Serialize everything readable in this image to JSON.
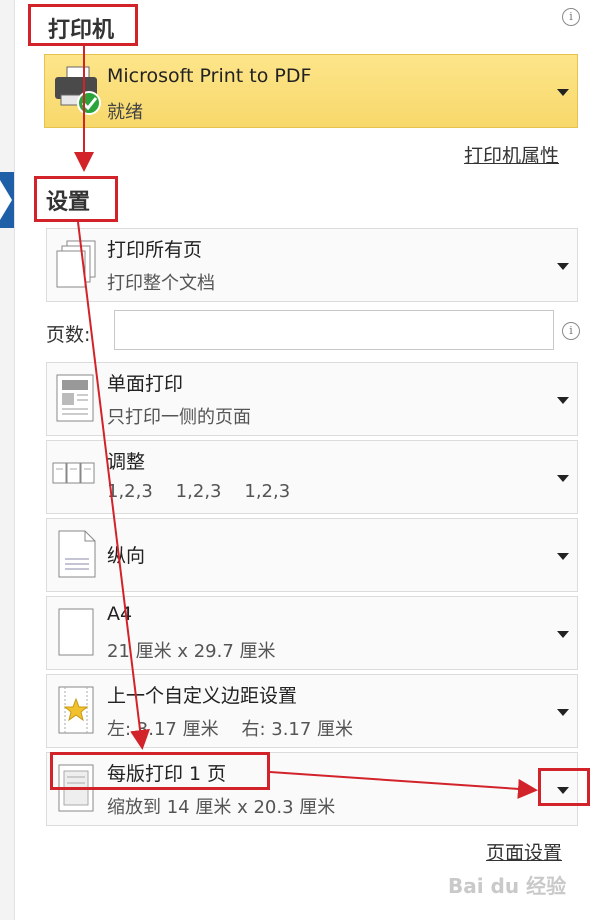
{
  "printer_section": {
    "title": "打印机",
    "printer_name": "Microsoft Print to PDF",
    "printer_status": "就绪",
    "properties_link": "打印机属性"
  },
  "settings_section": {
    "title": "设置",
    "pages_label": "页数:",
    "pages_value": "",
    "rows": [
      {
        "title": "打印所有页",
        "subtitle": "打印整个文档"
      },
      {
        "title": "单面打印",
        "subtitle": "只打印一侧的页面"
      },
      {
        "title": "调整",
        "subtitle": "1,2,3    1,2,3    1,2,3"
      },
      {
        "title": "纵向",
        "subtitle": ""
      },
      {
        "title": "A4",
        "subtitle": "21 厘米 x 29.7 厘米"
      },
      {
        "title": "上一个自定义边距设置",
        "subtitle": "左: 3.17 厘米    右: 3.17 厘米"
      },
      {
        "title": "每版打印 1 页",
        "subtitle": "缩放到 14 厘米 x 20.3 厘米"
      }
    ],
    "page_setup_link": "页面设置"
  },
  "info_icon_glyph": "i",
  "watermark": "Bai du 经验",
  "colors": {
    "highlight": "#f7d86b",
    "annotation_red": "#d2232a",
    "accent_blue": "#1f5fa8"
  }
}
